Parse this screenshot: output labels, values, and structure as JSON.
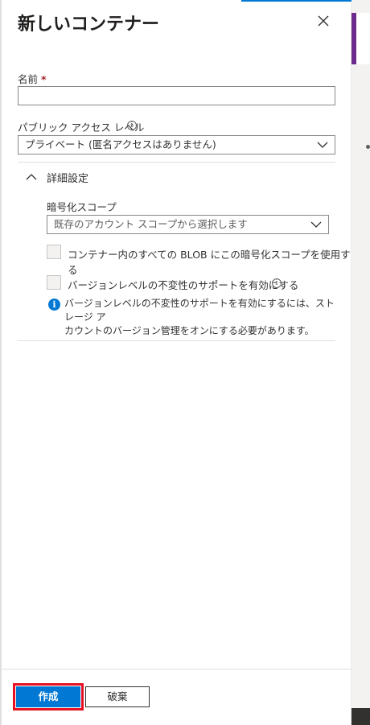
{
  "panel": {
    "title": "新しいコンテナー",
    "name_label": "名前",
    "required_mark": "*",
    "name_value": "",
    "access_label": "パブリック アクセス レベル",
    "access_value": "プライベート (匿名アクセスはありません)",
    "advanced_label": "詳細設定",
    "scope_label": "暗号化スコープ",
    "scope_placeholder": "既存のアカウント スコープから選択します",
    "checkbox1_label": "コンテナー内のすべての BLOB にこの暗号化スコープを使用する",
    "checkbox2_label": "バージョンレベルの不変性のサポートを有効にする",
    "note_line1": "バージョンレベルの不変性のサポートを有効にするには、ストレージ ア",
    "note_line2": "カウントのバージョン管理をオンにする必要があります。"
  },
  "footer": {
    "create_label": "作成",
    "discard_label": "破棄"
  },
  "colors": {
    "accent": "#0078d4",
    "highlight": "#e81123",
    "required": "#a4262c"
  },
  "icons": [
    "close-icon",
    "chevron-down-icon",
    "chevron-up-icon",
    "info-icon"
  ]
}
